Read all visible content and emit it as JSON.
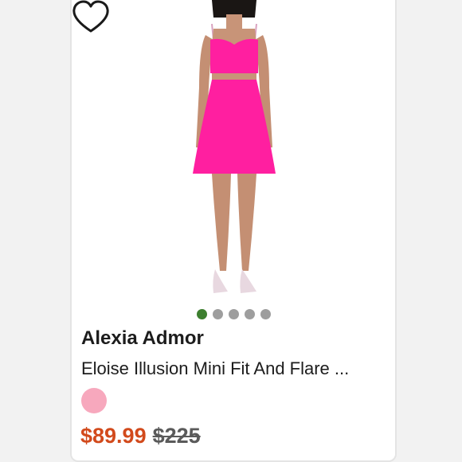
{
  "product": {
    "image_alt": "Model wearing pink two-piece mini dress",
    "brand": "Alexia Admor",
    "title": "Eloise Illusion Mini Fit And Flare ...",
    "price_sale": "$89.99",
    "price_original": "$225",
    "swatch_color": "#f7a8bd",
    "dress_color": "#ff1fa0"
  },
  "carousel": {
    "count": 5,
    "active_index": 0
  },
  "colors": {
    "sale": "#d24a1c",
    "active_dot": "#3d7f2f",
    "inactive_dot": "#9e9e9e"
  }
}
